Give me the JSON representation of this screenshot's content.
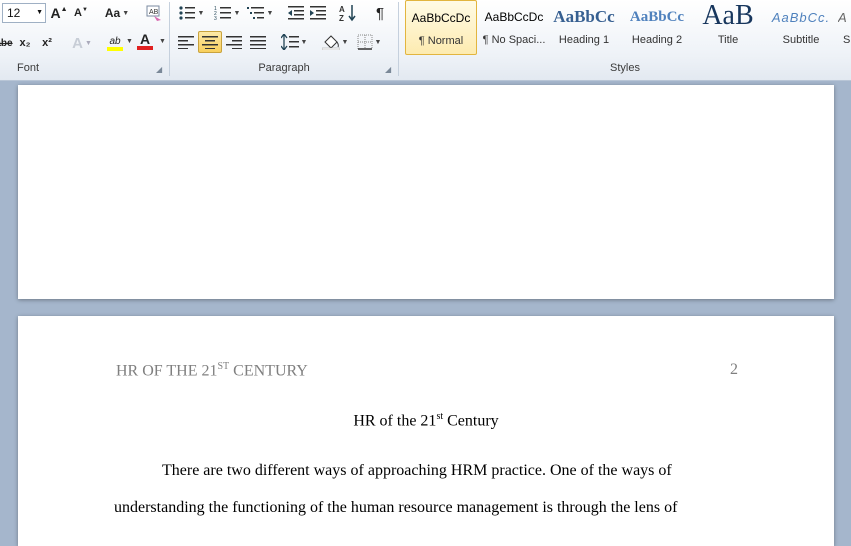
{
  "font": {
    "size": "12",
    "label": "Font",
    "grow_glyph": "A",
    "shrink_glyph": "A",
    "case_glyph": "Aa",
    "strike_glyph": "abe",
    "sub_glyph": "x₂",
    "sup_glyph": "x²",
    "clear_glyph": "AB",
    "effects_glyph": "A",
    "highlight_glyph": "ab",
    "color_glyph": "A",
    "highlight_color": "#ffff00",
    "font_color": "#e02020"
  },
  "paragraph": {
    "label": "Paragraph",
    "pilcrow": "¶"
  },
  "styles": {
    "label": "Styles",
    "items": [
      {
        "preview": "AaBbCcDc",
        "name": "¶ Normal"
      },
      {
        "preview": "AaBbCcDc",
        "name": "¶ No Spaci..."
      },
      {
        "preview": "AaBbCc",
        "name": "Heading 1"
      },
      {
        "preview": "AaBbCc",
        "name": "Heading 2"
      },
      {
        "preview": "AaB",
        "name": "Title"
      },
      {
        "preview": "AaBbCc.",
        "name": "Subtitle"
      },
      {
        "preview": "A",
        "name": "S"
      }
    ]
  },
  "document": {
    "header_left": "HR OF THE 21",
    "header_left_sup": "ST",
    "header_left_after": " CENTURY",
    "page_number": "2",
    "title": "HR of the 21",
    "title_sup": "st",
    "title_after": " Century",
    "line1": "There are two different ways of approaching HRM practice. One of the ways of",
    "line2": "understanding the functioning of the human resource management is through the lens of"
  }
}
